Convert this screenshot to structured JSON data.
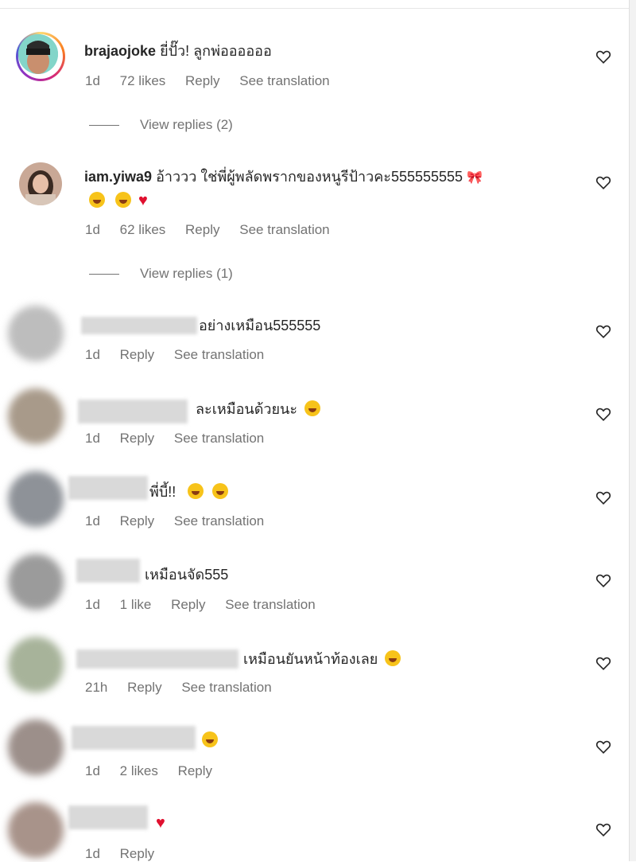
{
  "ui": {
    "view_replies_label": "View replies",
    "reply_label": "Reply",
    "see_translation_label": "See translation",
    "heart_icon": "heart-outline-icon"
  },
  "comments": [
    {
      "username": "brajaojoke",
      "text": "ยี่ปั๊ว! ลูกพ่ออออออ",
      "time": "1d",
      "likes": "72 likes",
      "view_replies": "View replies (2)"
    },
    {
      "username": "iam.yiwa9",
      "text": "อ้าววว ใช่พี่ผู้พลัดพรากของหนูรีป้าวคะ555555555",
      "time": "1d",
      "likes": "62 likes",
      "view_replies": "View replies (1)"
    },
    {
      "text": "อย่างเหมือน555555",
      "time": "1d"
    },
    {
      "text": "ละเหมือนด้วยนะ",
      "time": "1d"
    },
    {
      "text": "พี่บี้!!",
      "time": "1d"
    },
    {
      "text": "เหมือนจัด555",
      "time": "1d",
      "likes": "1 like"
    },
    {
      "text": "เหมือนยันหน้าท้องเลย",
      "time": "21h"
    },
    {
      "text": "",
      "time": "1d",
      "likes": "2 likes"
    },
    {
      "text": "",
      "time": "1d"
    }
  ]
}
